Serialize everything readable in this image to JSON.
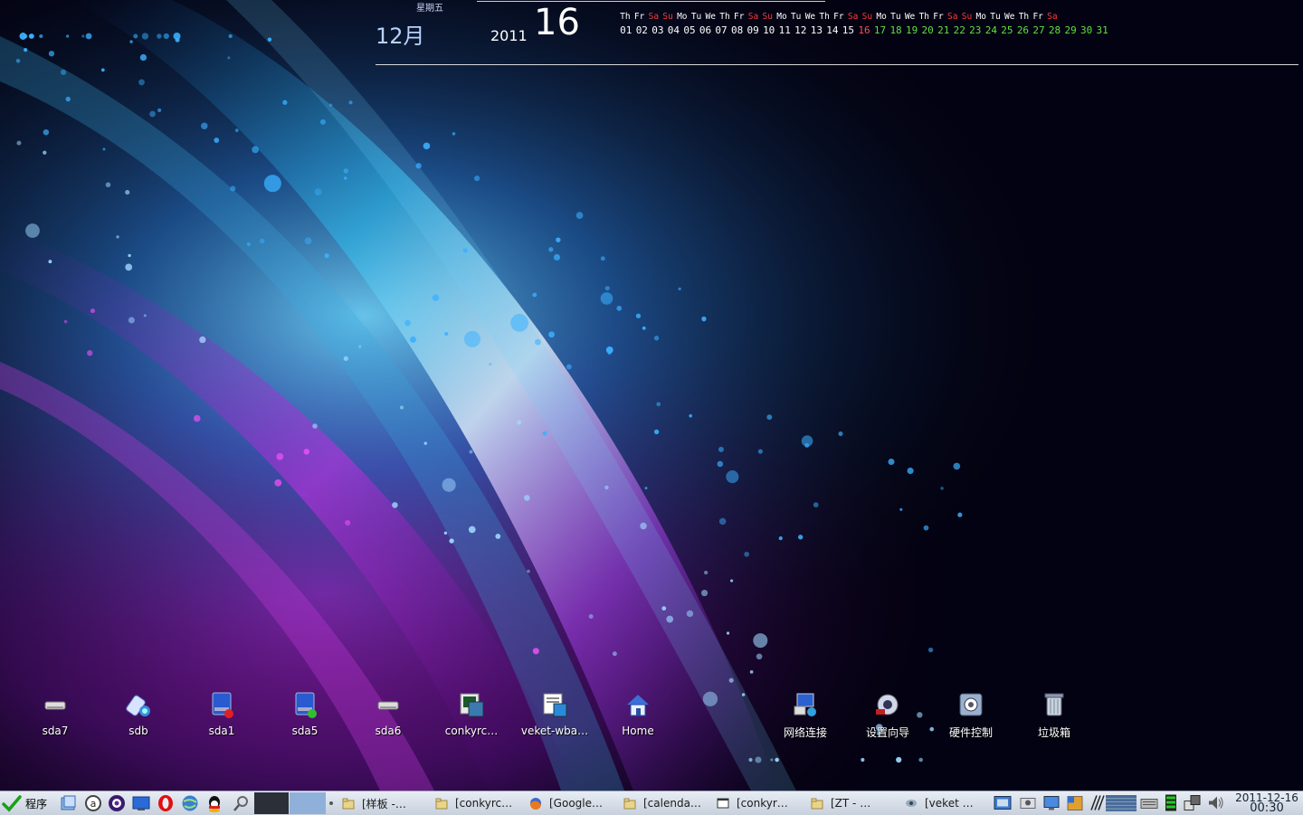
{
  "conky": {
    "weekday": "星期五",
    "month": "12月",
    "year": "2011",
    "day": "16",
    "weekdays": [
      {
        "t": "Th",
        "w": false
      },
      {
        "t": "Fr",
        "w": false
      },
      {
        "t": "Sa",
        "w": true
      },
      {
        "t": "Su",
        "w": true
      },
      {
        "t": "Mo",
        "w": false
      },
      {
        "t": "Tu",
        "w": false
      },
      {
        "t": "We",
        "w": false
      },
      {
        "t": "Th",
        "w": false
      },
      {
        "t": "Fr",
        "w": false
      },
      {
        "t": "Sa",
        "w": true
      },
      {
        "t": "Su",
        "w": true
      },
      {
        "t": "Mo",
        "w": false
      },
      {
        "t": "Tu",
        "w": false
      },
      {
        "t": "We",
        "w": false
      },
      {
        "t": "Th",
        "w": false
      },
      {
        "t": "Fr",
        "w": false
      },
      {
        "t": "Sa",
        "w": true
      },
      {
        "t": "Su",
        "w": true
      },
      {
        "t": "Mo",
        "w": false
      },
      {
        "t": "Tu",
        "w": false
      },
      {
        "t": "We",
        "w": false
      },
      {
        "t": "Th",
        "w": false
      },
      {
        "t": "Fr",
        "w": false
      },
      {
        "t": "Sa",
        "w": true
      },
      {
        "t": "Su",
        "w": true
      },
      {
        "t": "Mo",
        "w": false
      },
      {
        "t": "Tu",
        "w": false
      },
      {
        "t": "We",
        "w": false
      },
      {
        "t": "Th",
        "w": false
      },
      {
        "t": "Fr",
        "w": false
      },
      {
        "t": "Sa",
        "w": true
      }
    ],
    "days_past": [
      "01",
      "02",
      "03",
      "04",
      "05",
      "06",
      "07",
      "08",
      "09",
      "10",
      "11",
      "12",
      "13",
      "14",
      "15"
    ],
    "day_today": "16",
    "days_future": [
      "17",
      "18",
      "19",
      "20",
      "21",
      "22",
      "23",
      "24",
      "25",
      "26",
      "27",
      "28",
      "29",
      "30",
      "31"
    ],
    "colors": {
      "weekend": "#ff3a3a",
      "today": "#ff5050",
      "future": "#60e040"
    }
  },
  "desktop_icons": [
    {
      "label": "sda7",
      "icon": "drive-icon"
    },
    {
      "label": "sdb",
      "icon": "usb-drive-icon"
    },
    {
      "label": "sda1",
      "icon": "drive-mounted-icon"
    },
    {
      "label": "sda5",
      "icon": "drive-ok-icon"
    },
    {
      "label": "sda6",
      "icon": "drive-icon"
    },
    {
      "label": "conkyrc…",
      "icon": "script-file-icon"
    },
    {
      "label": "veket-wba…",
      "icon": "app-file-icon"
    },
    {
      "label": "Home",
      "icon": "home-icon"
    },
    {
      "label": "网络连接",
      "icon": "network-icon"
    },
    {
      "label": "设置向导",
      "icon": "setup-wizard-icon"
    },
    {
      "label": "硬件控制",
      "icon": "hardware-icon"
    },
    {
      "label": "垃圾箱",
      "icon": "trash-icon"
    }
  ],
  "taskbar": {
    "start_label": "程序",
    "quicklaunch": [
      "files-icon",
      "search-a-icon",
      "media-icon",
      "desktop-icon",
      "opera-icon",
      "globe-icon",
      "qq-icon",
      "magnifier-icon"
    ],
    "tasks": [
      {
        "label": "[样板 -…",
        "icon": "folder-icon"
      },
      {
        "label": "[conkyrc…",
        "icon": "folder-icon"
      },
      {
        "label": "[Google…",
        "icon": "firefox-icon"
      },
      {
        "label": "[calenda…",
        "icon": "folder-icon"
      },
      {
        "label": "[conkyr…",
        "icon": "window-icon"
      },
      {
        "label": "[ZT - …",
        "icon": "folder-icon"
      },
      {
        "label": "[veket …",
        "icon": "veket-icon"
      }
    ],
    "tray": [
      "screen-icon",
      "camera-icon",
      "monitor-icon",
      "package-icon",
      "signal-icon",
      "grid-icon",
      "keyboard-icon",
      "battery-icon",
      "network-tray-icon",
      "volume-icon"
    ],
    "clock": {
      "date": "2011-12-16",
      "time": "00:30"
    }
  }
}
